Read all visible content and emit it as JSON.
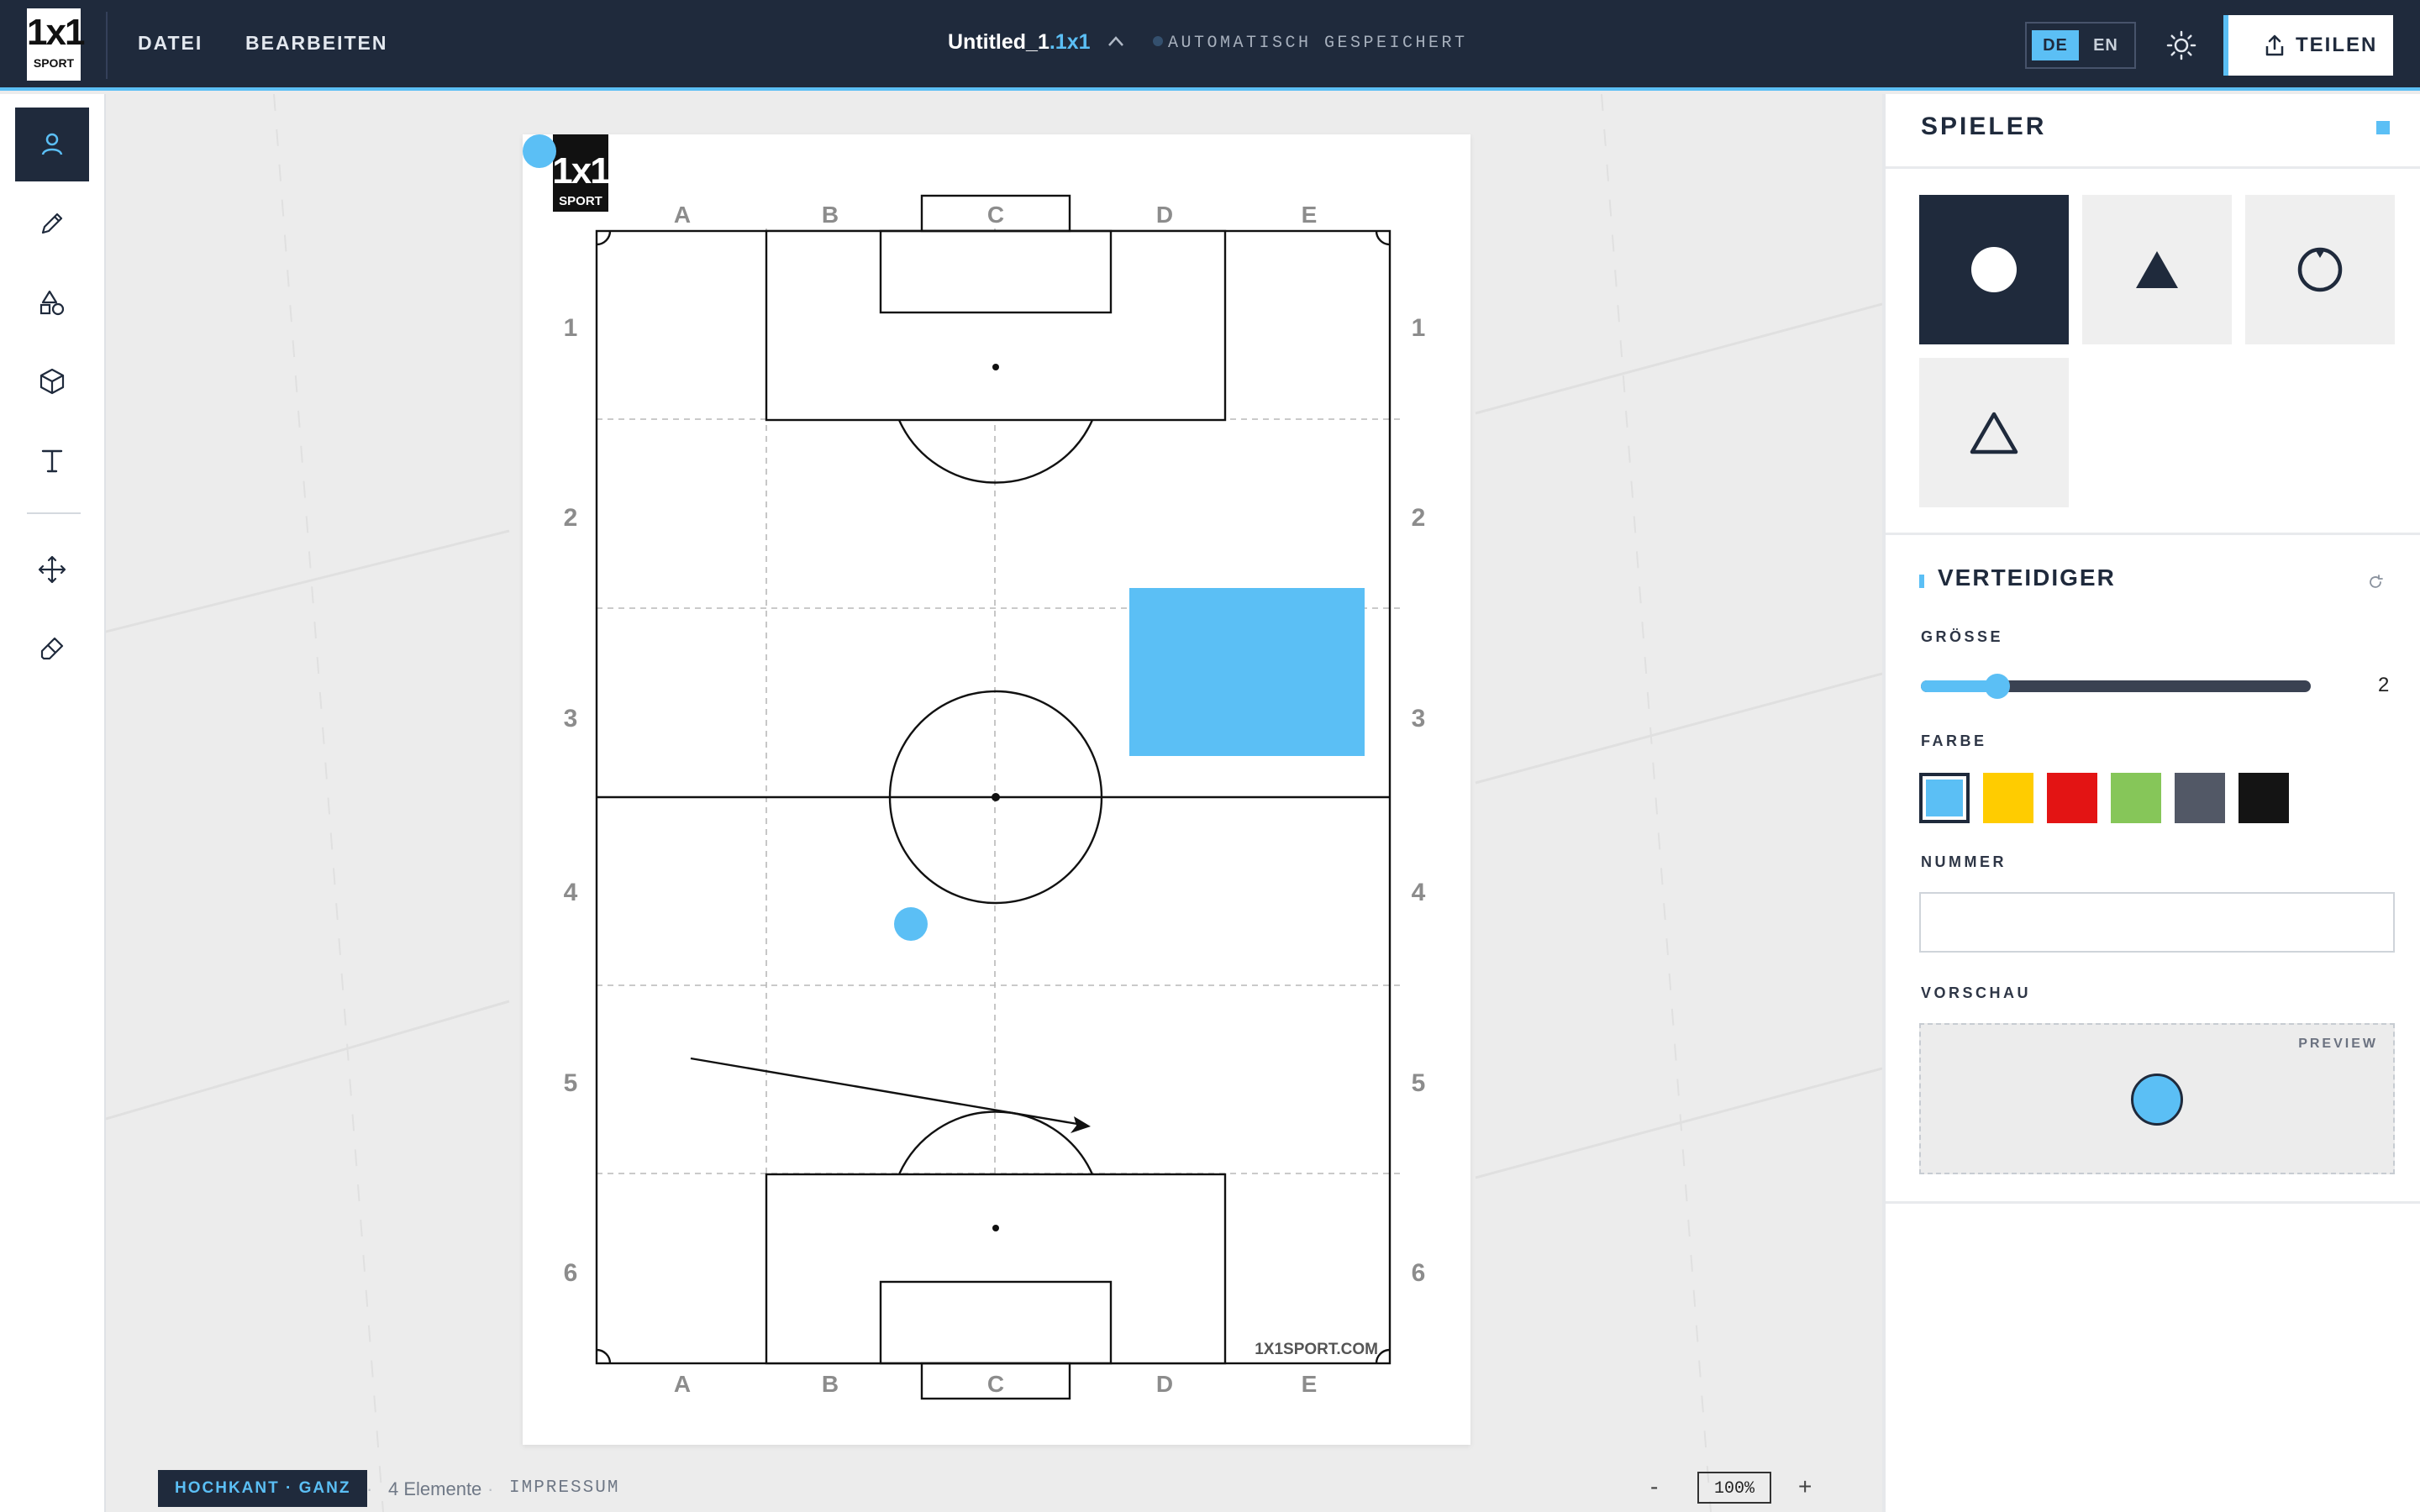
{
  "header": {
    "logo_mark": "1x1",
    "logo_sub": "SPORT",
    "menu": [
      {
        "label": "DATEI"
      },
      {
        "label": "BEARBEITEN"
      }
    ],
    "doc_name": "Untitled_1",
    "doc_ext": ".1x1",
    "doc_caret": "^",
    "save_status": "AUTOMATISCH GESPEICHERT",
    "lang_de": "DE",
    "lang_en": "EN",
    "share_label": "TEILEN"
  },
  "tools": {
    "items": [
      "player-icon",
      "pencil-icon",
      "shapes-icon",
      "cube-icon",
      "text-icon",
      "move-icon",
      "eraser-icon"
    ],
    "active": "player-icon"
  },
  "pitch": {
    "columns": [
      "A",
      "B",
      "C",
      "D",
      "E"
    ],
    "rows": [
      "1",
      "2",
      "3",
      "4",
      "5",
      "6"
    ],
    "watermark": "1X1SPORT.COM",
    "logo_mark": "1x1",
    "logo_sub": "SPORT",
    "colors": {
      "player": "#5bbff5",
      "line": "#111111",
      "grid": "#b9b9b9"
    }
  },
  "footer": {
    "orientation": "HOCHKANT · GANZ",
    "element_count": "4 Elemente",
    "separator": "·",
    "impressum": "IMPRESSUM",
    "zoom_minus": "-",
    "zoom": "100%",
    "zoom_plus": "+"
  },
  "panel": {
    "title": "SPIELER",
    "shapes": [
      {
        "icon": "circle-filled-icon",
        "selected": true
      },
      {
        "icon": "triangle-filled-icon",
        "selected": false
      },
      {
        "icon": "circle-outline-icon",
        "selected": false
      },
      {
        "icon": "triangle-outline-icon",
        "selected": false
      }
    ],
    "section_title": "VERTEIDIGER",
    "size_label": "GRÖSSE",
    "size_value": "2",
    "color_label": "FARBE",
    "colors": [
      "#5bbff5",
      "#ffcc00",
      "#e31414",
      "#86c659",
      "#525866",
      "#141414"
    ],
    "selected_color": "#5bbff5",
    "number_label": "NUMMER",
    "number_value": "",
    "preview_label": "VORSCHAU",
    "preview_tag": "PREVIEW"
  }
}
